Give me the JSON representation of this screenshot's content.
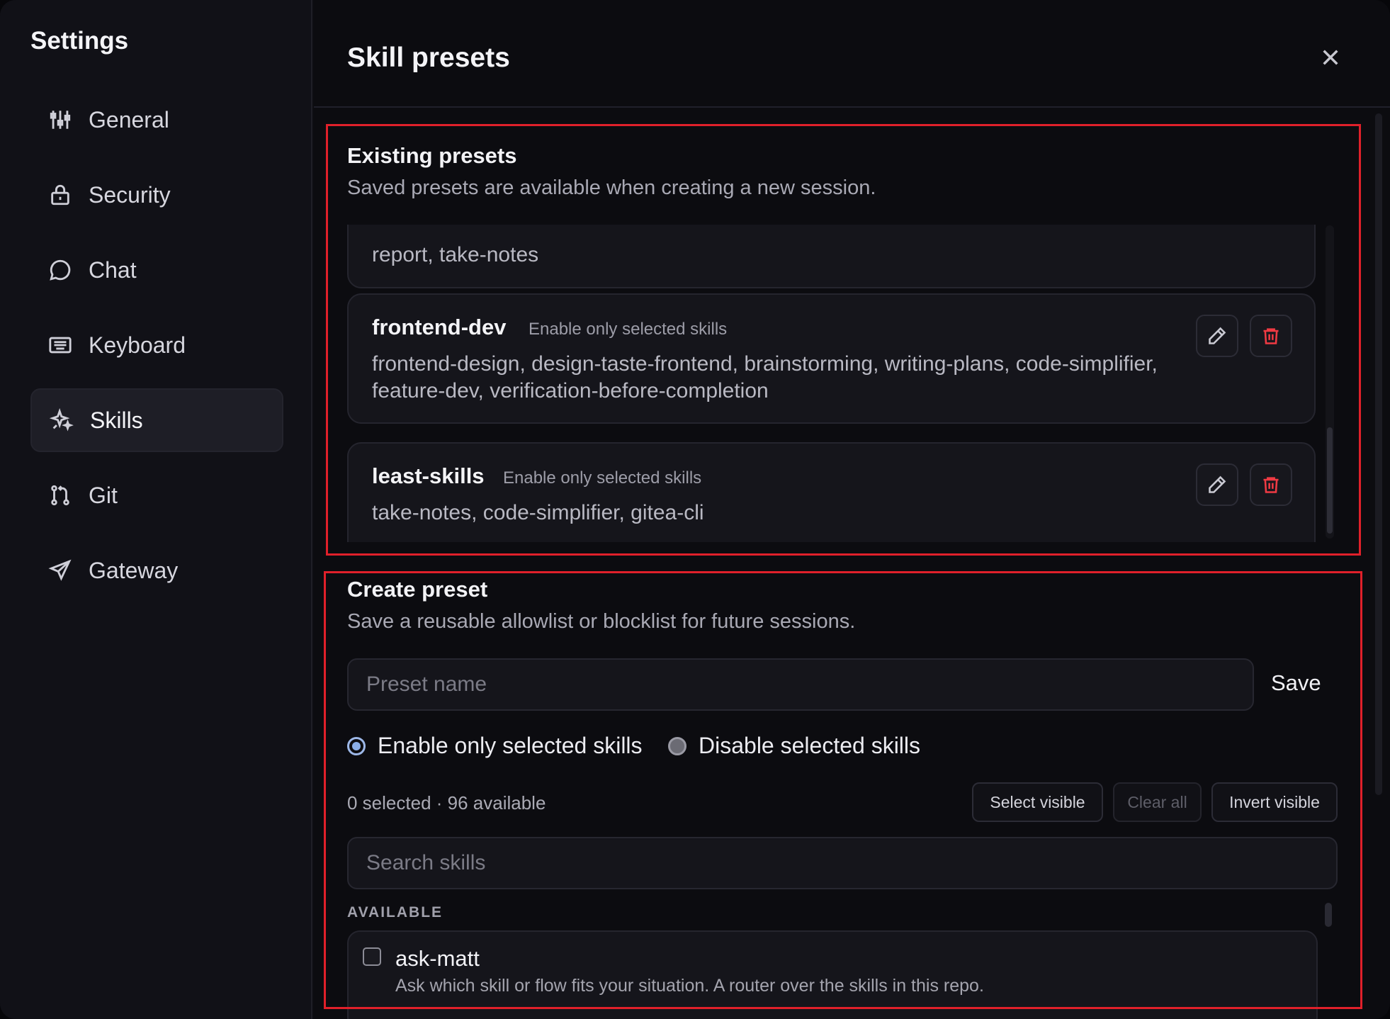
{
  "sidebar": {
    "title": "Settings",
    "items": [
      {
        "label": "General",
        "icon": "sliders-icon"
      },
      {
        "label": "Security",
        "icon": "lock-icon"
      },
      {
        "label": "Chat",
        "icon": "chat-bubble-icon"
      },
      {
        "label": "Keyboard",
        "icon": "keyboard-icon"
      },
      {
        "label": "Skills",
        "icon": "sparkle-icon",
        "active": true
      },
      {
        "label": "Git",
        "icon": "git-branch-icon"
      },
      {
        "label": "Gateway",
        "icon": "send-icon"
      }
    ]
  },
  "main": {
    "title": "Skill presets",
    "close_icon": "close-icon"
  },
  "existing": {
    "title": "Existing presets",
    "subtitle": "Saved presets are available when creating a new session.",
    "partial_card_text": "report, take-notes",
    "presets": [
      {
        "name": "frontend-dev",
        "mode": "Enable only selected skills",
        "skills": "frontend-design, design-taste-frontend, brainstorming, writing-plans, code-simplifier, feature-dev, verification-before-completion"
      },
      {
        "name": "least-skills",
        "mode": "Enable only selected skills",
        "skills": "take-notes, code-simplifier, gitea-cli"
      }
    ]
  },
  "create": {
    "title": "Create preset",
    "subtitle": "Save a reusable allowlist or blocklist for future sessions.",
    "name_placeholder": "Preset name",
    "name_value": "",
    "save_label": "Save",
    "mode_options": [
      {
        "label": "Enable only selected skills",
        "selected": true
      },
      {
        "label": "Disable selected skills",
        "selected": false
      }
    ],
    "count_text": "0 selected · 96 available",
    "select_visible_label": "Select visible",
    "clear_all_label": "Clear all",
    "invert_visible_label": "Invert visible",
    "search_placeholder": "Search skills",
    "search_value": "",
    "available_label": "AVAILABLE",
    "skills": [
      {
        "name": "ask-matt",
        "description": "Ask which skill or flow fits your situation. A router over the skills in this repo.",
        "checked": false
      }
    ]
  },
  "colors": {
    "highlight": "#e0202a",
    "danger": "#ef3a43",
    "radio_accent": "#8aaee8"
  }
}
